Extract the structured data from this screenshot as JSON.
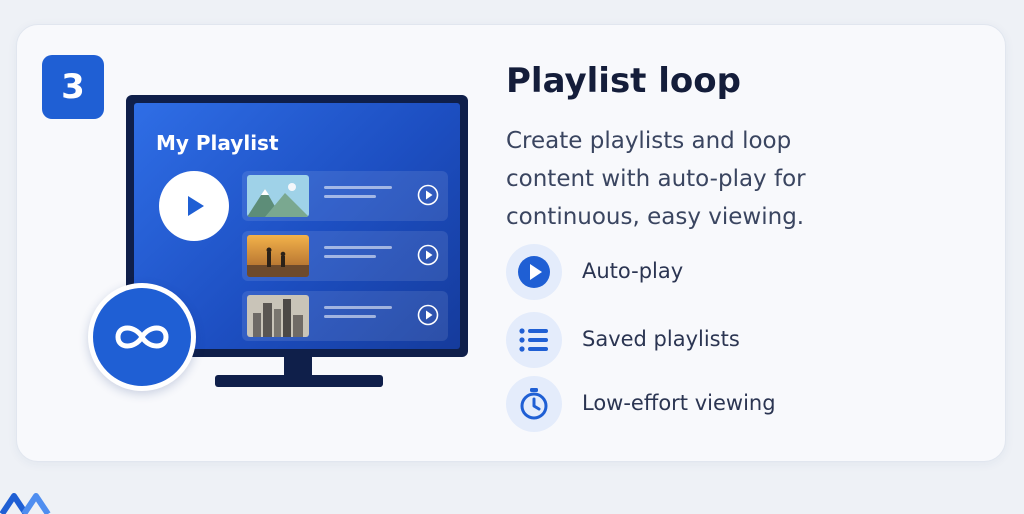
{
  "step": {
    "number": "3"
  },
  "tv": {
    "playlist_title": "My Playlist",
    "items": [
      {
        "thumb": "mountains-thumbnail",
        "play_icon": "play-circle-icon"
      },
      {
        "thumb": "sunset-people-thumbnail",
        "play_icon": "play-circle-icon"
      },
      {
        "thumb": "city-skyline-thumbnail",
        "play_icon": "play-circle-icon"
      }
    ],
    "loop_icon": "infinity-icon"
  },
  "content": {
    "title": "Playlist loop",
    "description": "Create playlists and loop content with auto-play for continuous, easy viewing.",
    "features": [
      {
        "icon": "play-icon",
        "label": "Auto-play"
      },
      {
        "icon": "list-icon",
        "label": "Saved playlists"
      },
      {
        "icon": "stopwatch-icon",
        "label": "Low-effort viewing"
      }
    ]
  },
  "colors": {
    "accent": "#1f5fd4",
    "tv_frame": "#0f1f4a",
    "screen": "#2f6ee6",
    "heading": "#141d3a",
    "body_text": "#3a4560",
    "icon_bg": "#e4ecfb"
  }
}
